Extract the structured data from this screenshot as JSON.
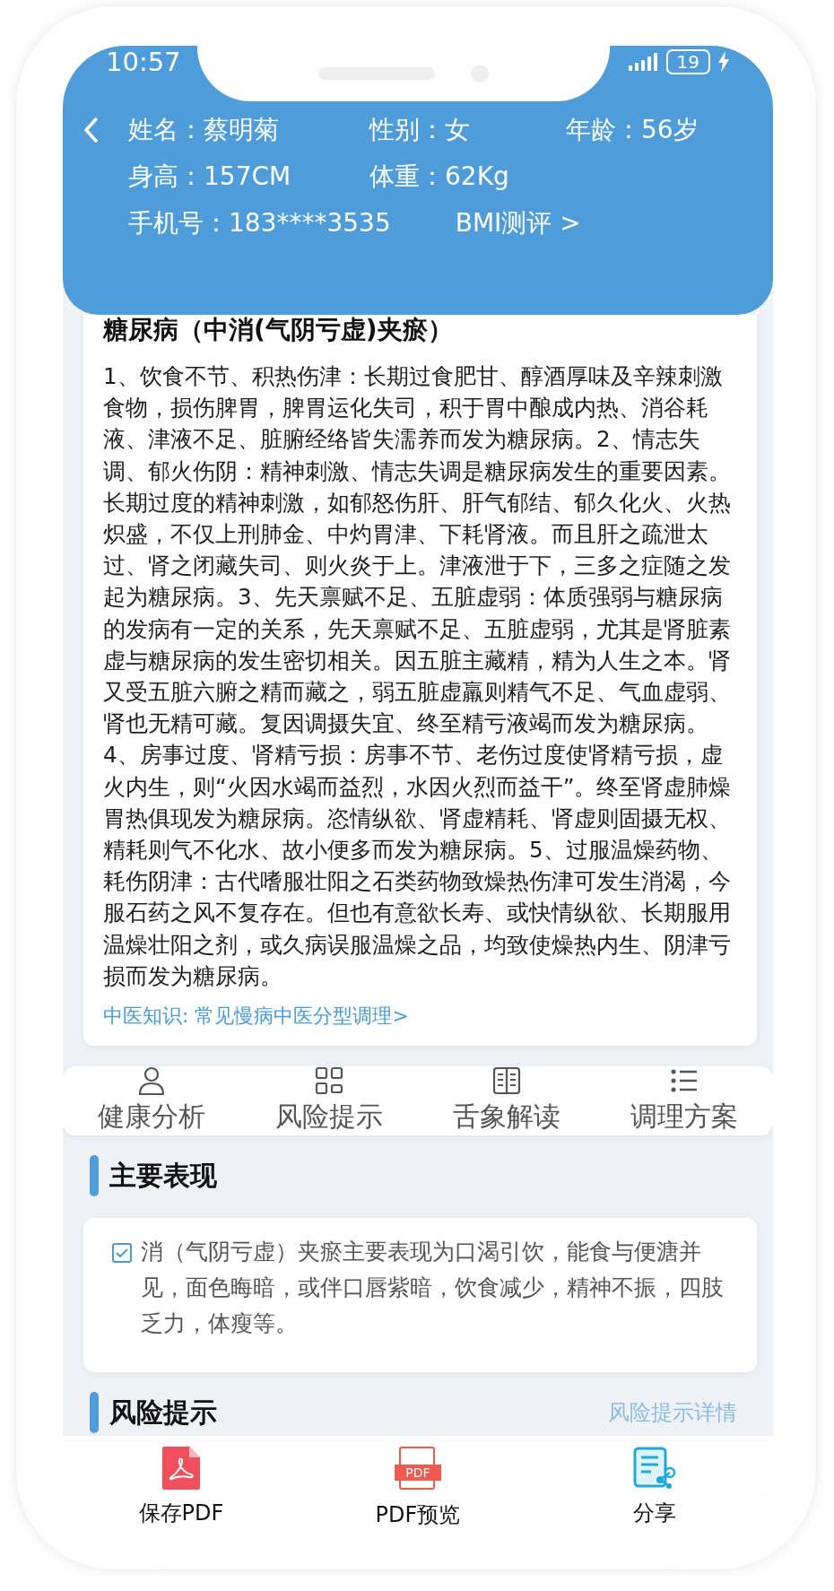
{
  "status_bar": {
    "time": "10:57",
    "battery": "19"
  },
  "header": {
    "rows": [
      {
        "items": [
          "姓名：蔡明菊",
          "性别：女",
          "年龄：56岁"
        ]
      },
      {
        "items": [
          "身高：157CM",
          "体重：62Kg"
        ]
      },
      {
        "items": [
          "手机号：183****3535"
        ],
        "link": "BMI测评 >"
      }
    ]
  },
  "diagnosis": {
    "title": "糖尿病（中消(气阴亏虚)夹瘀）",
    "body": "1、饮食不节、积热伤津：长期过食肥甘、醇酒厚味及辛辣刺激食物，损伤脾胃，脾胃运化失司，积于胃中酿成内热、消谷耗液、津液不足、脏腑经络皆失濡养而发为糖尿病。2、情志失调、郁火伤阴：精神刺激、情志失调是糖尿病发生的重要因素。长期过度的精神刺激，如郁怒伤肝、肝气郁结、郁久化火、火热炽盛，不仅上刑肺金、中灼胃津、下耗肾液。而且肝之疏泄太过、肾之闭藏失司、则火炎于上。津液泄于下，三多之症随之发起为糖尿病。3、先天禀赋不足、五脏虚弱：体质强弱与糖尿病的发病有一定的关系，先天禀赋不足、五脏虚弱，尤其是肾脏素虚与糖尿病的发生密切相关。因五脏主藏精，精为人生之本。肾又受五脏六腑之精而藏之，弱五脏虚羸则精气不足、气血虚弱、肾也无精可藏。复因调摄失宜、终至精亏液竭而发为糖尿病。4、房事过度、肾精亏损：房事不节、老伤过度使肾精亏损，虚火内生，则“火因水竭而益烈，水因火烈而益干”。终至肾虚肺燥胃热俱现发为糖尿病。恣情纵欲、肾虚精耗、肾虚则固摄无权、精耗则气不化水、故小便多而发为糖尿病。5、过服温燥药物、耗伤阴津：古代嗜服壮阳之石类药物致燥热伤津可发生消渴，今服石药之风不复存在。但也有意欲长寿、或快情纵欲、长期服用温燥壮阳之剂，或久病误服温燥之品，均致使燥热内生、阴津亏损而发为糖尿病。",
    "link": "中医知识: 常见慢病中医分型调理>"
  },
  "tabs": [
    {
      "label": "健康分析"
    },
    {
      "label": "风险提示"
    },
    {
      "label": "舌象解读"
    },
    {
      "label": "调理方案"
    }
  ],
  "sections": [
    {
      "title": "主要表现",
      "items": [
        {
          "checked": true,
          "text": "消（气阴亏虚）夹瘀主要表现为口渴引饮，能食与便溏并见，面色晦暗，或伴口唇紫暗，饮食减少，精神不振，四肢乏力，体瘦等。"
        }
      ]
    },
    {
      "title": "风险提示",
      "link": "风险提示详情"
    }
  ],
  "actions": [
    {
      "kind": "save",
      "label": "保存PDF"
    },
    {
      "kind": "preview",
      "label": "PDF预览",
      "icon_text": "PDF"
    },
    {
      "kind": "share",
      "label": "分享"
    }
  ]
}
